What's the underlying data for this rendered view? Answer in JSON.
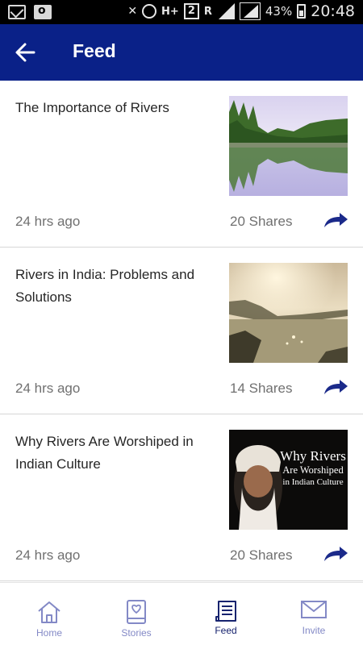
{
  "status_bar": {
    "network": "H+",
    "sim": "2",
    "roaming": "R",
    "battery": "43%",
    "time": "20:48"
  },
  "appbar": {
    "title": "Feed",
    "back_icon": "arrow-left-icon"
  },
  "feed": [
    {
      "title": "The Importance of Rivers",
      "time": "24 hrs ago",
      "shares": "20 Shares",
      "image": "lake-reflection-image"
    },
    {
      "title": "Rivers in India: Problems and Solutions",
      "time": "24 hrs ago",
      "shares": "14 Shares",
      "image": "river-sunset-image"
    },
    {
      "title": "Why Rivers Are Worshiped in Indian Culture",
      "time": "24 hrs ago",
      "shares": "20 Shares",
      "image": "video-thumbnail-image",
      "thumb_text": [
        "Why Rivers",
        "Are Worshiped",
        "in Indian Culture"
      ]
    }
  ],
  "bottom_nav": [
    {
      "label": "Home",
      "icon": "home-icon",
      "active": false
    },
    {
      "label": "Stories",
      "icon": "stories-icon",
      "active": false
    },
    {
      "label": "Feed",
      "icon": "feed-icon",
      "active": true
    },
    {
      "label": "Invite",
      "icon": "mail-icon",
      "active": false
    }
  ],
  "colors": {
    "appbar": "#0a2188",
    "share_arrow": "#1b2a8a",
    "nav_inactive": "#8389c6",
    "nav_active": "#17236e"
  }
}
